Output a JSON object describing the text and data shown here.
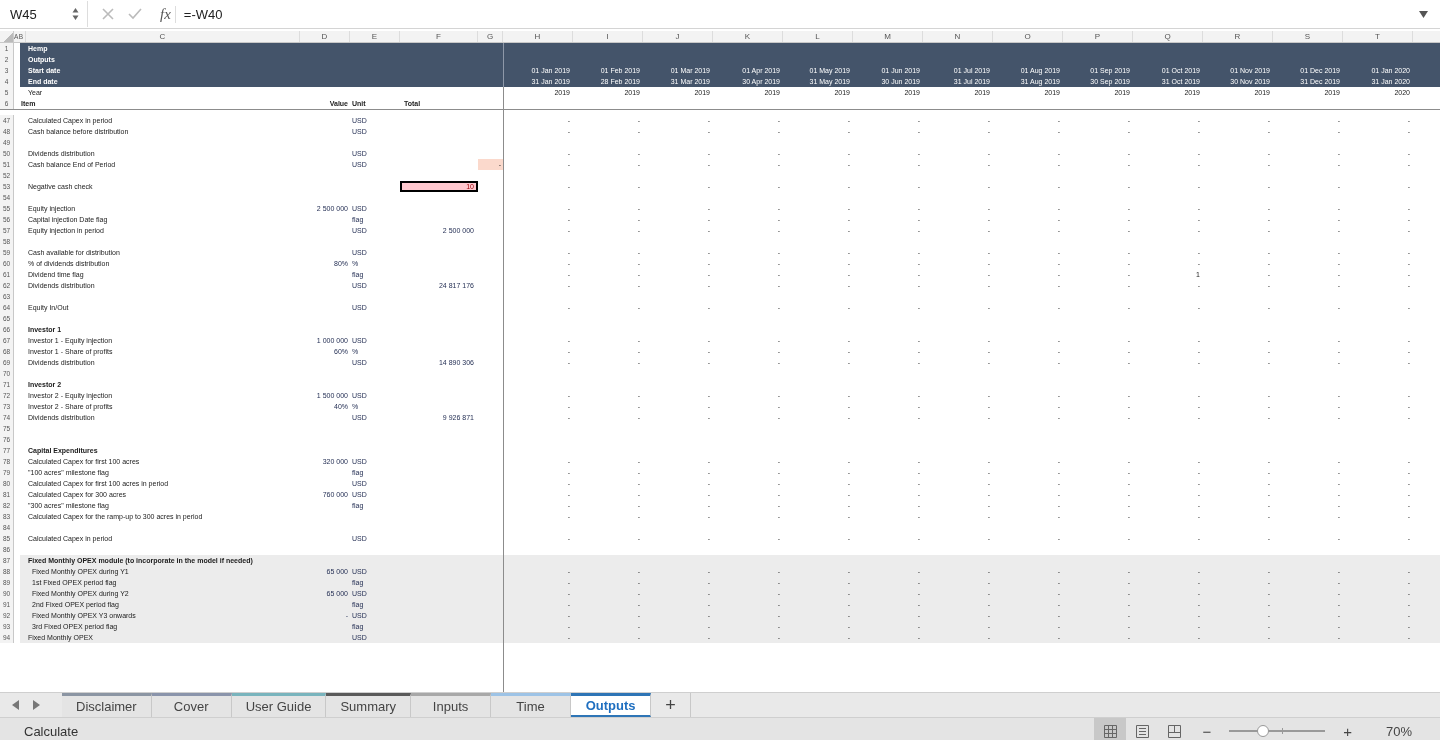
{
  "formula_bar": {
    "name_box": "W45",
    "fx": "fx",
    "formula": "=-W40"
  },
  "column_letters": {
    "ab": "A B",
    "frozen": [
      "C",
      "D",
      "E",
      "F",
      "G"
    ],
    "months": [
      "H",
      "I",
      "J",
      "K",
      "L",
      "M",
      "N",
      "O",
      "P",
      "Q",
      "R",
      "S",
      "T"
    ]
  },
  "header": {
    "title": "Hemp",
    "subtitle": "Outputs",
    "start_label": "Start date",
    "end_label": "End date",
    "year_label": "Year",
    "starts": [
      "01 Jan 2019",
      "01 Feb 2019",
      "01 Mar 2019",
      "01 Apr 2019",
      "01 May 2019",
      "01 Jun 2019",
      "01 Jul 2019",
      "01 Aug 2019",
      "01 Sep 2019",
      "01 Oct 2019",
      "01 Nov 2019",
      "01 Dec 2019",
      "01 Jan 2020"
    ],
    "ends": [
      "31 Jan 2019",
      "28 Feb 2019",
      "31 Mar 2019",
      "30 Apr 2019",
      "31 May 2019",
      "30 Jun 2019",
      "31 Jul 2019",
      "31 Aug 2019",
      "30 Sep 2019",
      "31 Oct 2019",
      "30 Nov 2019",
      "31 Dec 2019",
      "31 Jan 2020"
    ],
    "years": [
      "2019",
      "2019",
      "2019",
      "2019",
      "2019",
      "2019",
      "2019",
      "2019",
      "2019",
      "2019",
      "2019",
      "2019",
      "2020"
    ],
    "item": "Item",
    "value": "Value",
    "unit": "Unit",
    "total": "Total"
  },
  "header_row_numbers": [
    "1",
    "2",
    "3",
    "4",
    "5",
    "6"
  ],
  "rows": [
    {
      "num": "47",
      "kind": "item",
      "shaded": false,
      "label": "Calculated Capex in period",
      "unit": "USD",
      "cells": [
        "-",
        "-",
        "-",
        "-",
        "-",
        "-",
        "-",
        "-",
        "-",
        "-",
        "-",
        "-",
        "-"
      ]
    },
    {
      "num": "48",
      "kind": "item",
      "shaded": false,
      "label": "Cash balance before distribution",
      "unit": "USD",
      "cells": [
        "-",
        "-",
        "-",
        "-",
        "-",
        "-",
        "-",
        "-",
        "-",
        "-",
        "-",
        "-",
        "-"
      ]
    },
    {
      "num": "49",
      "kind": "blank",
      "shaded": false
    },
    {
      "num": "50",
      "kind": "item",
      "shaded": false,
      "label": "Dividends distribution",
      "unit": "USD",
      "cells": [
        "-",
        "-",
        "-",
        "-",
        "-",
        "-",
        "-",
        "-",
        "-",
        "-",
        "-",
        "-",
        "-"
      ]
    },
    {
      "num": "51",
      "kind": "item",
      "shaded": false,
      "label": "Cash balance End of Period",
      "unit": "USD",
      "g": "-",
      "g_highlight": true,
      "cells": [
        "-",
        "-",
        "-",
        "-",
        "-",
        "-",
        "-",
        "-",
        "-",
        "-",
        "-",
        "-",
        "-"
      ]
    },
    {
      "num": "52",
      "kind": "blank",
      "shaded": false
    },
    {
      "num": "53",
      "kind": "item",
      "shaded": false,
      "label": "Negative cash check",
      "total": "10",
      "alert": true,
      "cells": [
        "-",
        "-",
        "-",
        "-",
        "-",
        "-",
        "-",
        "-",
        "-",
        "-",
        "-",
        "-",
        "-"
      ]
    },
    {
      "num": "54",
      "kind": "blank",
      "shaded": false
    },
    {
      "num": "55",
      "kind": "item",
      "shaded": false,
      "label": "Equity injection",
      "value": "2 500 000",
      "unit": "USD",
      "cells": [
        "-",
        "-",
        "-",
        "-",
        "-",
        "-",
        "-",
        "-",
        "-",
        "-",
        "-",
        "-",
        "-"
      ]
    },
    {
      "num": "56",
      "kind": "item",
      "shaded": false,
      "label": "Capital injection Date flag",
      "unit": "flag",
      "cells": [
        "-",
        "-",
        "-",
        "-",
        "-",
        "-",
        "-",
        "-",
        "-",
        "-",
        "-",
        "-",
        "-"
      ]
    },
    {
      "num": "57",
      "kind": "item",
      "shaded": false,
      "label": "Equity injection in period",
      "unit": "USD",
      "total": "2 500 000",
      "alert": false,
      "cells": [
        "-",
        "-",
        "-",
        "-",
        "-",
        "-",
        "-",
        "-",
        "-",
        "-",
        "-",
        "-",
        "-"
      ]
    },
    {
      "num": "58",
      "kind": "blank",
      "shaded": false
    },
    {
      "num": "59",
      "kind": "item",
      "shaded": false,
      "label": "Cash available for distribution",
      "unit": "USD",
      "cells": [
        "-",
        "-",
        "-",
        "-",
        "-",
        "-",
        "-",
        "-",
        "-",
        "-",
        "-",
        "-",
        "-"
      ]
    },
    {
      "num": "60",
      "kind": "item",
      "shaded": false,
      "label": "% of dividends distribution",
      "value": "80%",
      "unit": "%",
      "cells": [
        "-",
        "-",
        "-",
        "-",
        "-",
        "-",
        "-",
        "-",
        "-",
        "-",
        "-",
        "-",
        "-"
      ]
    },
    {
      "num": "61",
      "kind": "item",
      "shaded": false,
      "label": "Dividend time flag",
      "unit": "flag",
      "cells": [
        "-",
        "-",
        "-",
        "-",
        "-",
        "-",
        "-",
        "-",
        "-",
        "1",
        "-",
        "-",
        "-"
      ]
    },
    {
      "num": "62",
      "kind": "item",
      "shaded": false,
      "label": "Dividends distribution",
      "unit": "USD",
      "total": "24 817 176",
      "alert": false,
      "cells": [
        "-",
        "-",
        "-",
        "-",
        "-",
        "-",
        "-",
        "-",
        "-",
        "-",
        "-",
        "-",
        "-"
      ]
    },
    {
      "num": "63",
      "kind": "blank",
      "shaded": false
    },
    {
      "num": "64",
      "kind": "item",
      "shaded": false,
      "label": "Equity In/Out",
      "unit": "USD",
      "cells": [
        "-",
        "-",
        "-",
        "-",
        "-",
        "-",
        "-",
        "-",
        "-",
        "-",
        "-",
        "-",
        "-"
      ]
    },
    {
      "num": "65",
      "kind": "blank",
      "shaded": false
    },
    {
      "num": "66",
      "kind": "heading",
      "shaded": false,
      "label": "Investor 1"
    },
    {
      "num": "67",
      "kind": "item",
      "shaded": false,
      "label": "Investor 1 - Equity injection",
      "value": "1 000 000",
      "unit": "USD",
      "cells": [
        "-",
        "-",
        "-",
        "-",
        "-",
        "-",
        "-",
        "-",
        "-",
        "-",
        "-",
        "-",
        "-"
      ]
    },
    {
      "num": "68",
      "kind": "item",
      "shaded": false,
      "label": "Investor 1 - Share of profits",
      "value": "60%",
      "unit": "%",
      "cells": [
        "-",
        "-",
        "-",
        "-",
        "-",
        "-",
        "-",
        "-",
        "-",
        "-",
        "-",
        "-",
        "-"
      ]
    },
    {
      "num": "69",
      "kind": "item",
      "shaded": false,
      "label": "Dividends distribution",
      "unit": "USD",
      "total": "14 890 306",
      "alert": false,
      "cells": [
        "-",
        "-",
        "-",
        "-",
        "-",
        "-",
        "-",
        "-",
        "-",
        "-",
        "-",
        "-",
        "-"
      ]
    },
    {
      "num": "70",
      "kind": "blank",
      "shaded": false
    },
    {
      "num": "71",
      "kind": "heading",
      "shaded": false,
      "label": "Investor 2"
    },
    {
      "num": "72",
      "kind": "item",
      "shaded": false,
      "label": "Investor 2 - Equity injection",
      "value": "1 500 000",
      "unit": "USD",
      "cells": [
        "-",
        "-",
        "-",
        "-",
        "-",
        "-",
        "-",
        "-",
        "-",
        "-",
        "-",
        "-",
        "-"
      ]
    },
    {
      "num": "73",
      "kind": "item",
      "shaded": false,
      "label": "Investor 2 - Share of profits",
      "value": "40%",
      "unit": "%",
      "cells": [
        "-",
        "-",
        "-",
        "-",
        "-",
        "-",
        "-",
        "-",
        "-",
        "-",
        "-",
        "-",
        "-"
      ]
    },
    {
      "num": "74",
      "kind": "item",
      "shaded": false,
      "label": "Dividends distribution",
      "unit": "USD",
      "total": "9 926 871",
      "alert": false,
      "cells": [
        "-",
        "-",
        "-",
        "-",
        "-",
        "-",
        "-",
        "-",
        "-",
        "-",
        "-",
        "-",
        "-"
      ]
    },
    {
      "num": "75",
      "kind": "blank",
      "shaded": false
    },
    {
      "num": "76",
      "kind": "blank",
      "shaded": false
    },
    {
      "num": "77",
      "kind": "heading",
      "shaded": false,
      "label": "Capital Expenditures"
    },
    {
      "num": "78",
      "kind": "item",
      "shaded": false,
      "label": "Calculated Capex for first 100 acres",
      "value": "320 000",
      "unit": "USD",
      "cells": [
        "-",
        "-",
        "-",
        "-",
        "-",
        "-",
        "-",
        "-",
        "-",
        "-",
        "-",
        "-",
        "-"
      ]
    },
    {
      "num": "79",
      "kind": "item",
      "shaded": false,
      "label": "\"100 acres\" milestone flag",
      "unit": "flag",
      "cells": [
        "-",
        "-",
        "-",
        "-",
        "-",
        "-",
        "-",
        "-",
        "-",
        "-",
        "-",
        "-",
        "-"
      ]
    },
    {
      "num": "80",
      "kind": "item",
      "shaded": false,
      "label": "Calculated Capex for first 100 acres in period",
      "unit": "USD",
      "cells": [
        "-",
        "-",
        "-",
        "-",
        "-",
        "-",
        "-",
        "-",
        "-",
        "-",
        "-",
        "-",
        "-"
      ]
    },
    {
      "num": "81",
      "kind": "item",
      "shaded": false,
      "label": "Calculated Capex for 300 acres",
      "value": "760 000",
      "unit": "USD",
      "cells": [
        "-",
        "-",
        "-",
        "-",
        "-",
        "-",
        "-",
        "-",
        "-",
        "-",
        "-",
        "-",
        "-"
      ]
    },
    {
      "num": "82",
      "kind": "item",
      "shaded": false,
      "label": "\"300 acres\" milestone flag",
      "unit": "flag",
      "cells": [
        "-",
        "-",
        "-",
        "-",
        "-",
        "-",
        "-",
        "-",
        "-",
        "-",
        "-",
        "-",
        "-"
      ]
    },
    {
      "num": "83",
      "kind": "item",
      "shaded": false,
      "label": "Calculated Capex for the ramp-up to 300 acres in period",
      "cells": [
        "-",
        "-",
        "-",
        "-",
        "-",
        "-",
        "-",
        "-",
        "-",
        "-",
        "-",
        "-",
        "-"
      ]
    },
    {
      "num": "84",
      "kind": "blank",
      "shaded": false
    },
    {
      "num": "85",
      "kind": "item",
      "shaded": false,
      "label": "Calculated Capex in period",
      "unit": "USD",
      "cells": [
        "-",
        "-",
        "-",
        "-",
        "-",
        "-",
        "-",
        "-",
        "-",
        "-",
        "-",
        "-",
        "-"
      ]
    },
    {
      "num": "86",
      "kind": "blank",
      "shaded": false
    },
    {
      "num": "87",
      "kind": "heading",
      "shaded": true,
      "label": "Fixed Monthly OPEX module (to incorporate in the model if needed)"
    },
    {
      "num": "88",
      "kind": "sub",
      "shaded": true,
      "label": "Fixed Monthly OPEX during Y1",
      "value": "65 000",
      "unit": "USD",
      "cells": [
        "-",
        "-",
        "-",
        "-",
        "-",
        "-",
        "-",
        "-",
        "-",
        "-",
        "-",
        "-",
        "-"
      ]
    },
    {
      "num": "89",
      "kind": "sub",
      "shaded": true,
      "label": "1st Fixed OPEX period flag",
      "unit": "flag",
      "cells": [
        "-",
        "-",
        "-",
        "-",
        "-",
        "-",
        "-",
        "-",
        "-",
        "-",
        "-",
        "-",
        "-"
      ]
    },
    {
      "num": "90",
      "kind": "sub",
      "shaded": true,
      "label": "Fixed Monthly OPEX during Y2",
      "value": "65 000",
      "unit": "USD",
      "cells": [
        "-",
        "-",
        "-",
        "-",
        "-",
        "-",
        "-",
        "-",
        "-",
        "-",
        "-",
        "-",
        "-"
      ]
    },
    {
      "num": "91",
      "kind": "sub",
      "shaded": true,
      "label": "2nd Fixed OPEX period flag",
      "unit": "flag",
      "cells": [
        "-",
        "-",
        "-",
        "-",
        "-",
        "-",
        "-",
        "-",
        "-",
        "-",
        "-",
        "-",
        "-"
      ]
    },
    {
      "num": "92",
      "kind": "sub",
      "shaded": true,
      "label": "Fixed Monthly OPEX Y3 onwards",
      "value": "-",
      "unit": "USD",
      "cells": [
        "-",
        "-",
        "-",
        "-",
        "-",
        "-",
        "-",
        "-",
        "-",
        "-",
        "-",
        "-",
        "-"
      ]
    },
    {
      "num": "93",
      "kind": "sub",
      "shaded": true,
      "label": "3rd Fixed OPEX period flag",
      "unit": "flag",
      "cells": [
        "-",
        "-",
        "-",
        "-",
        "-",
        "-",
        "-",
        "-",
        "-",
        "-",
        "-",
        "-",
        "-"
      ]
    },
    {
      "num": "94",
      "kind": "item",
      "shaded": true,
      "label": "Fixed Monthly OPEX",
      "unit": "USD",
      "cells": [
        "-",
        "-",
        "-",
        "-",
        "-",
        "-",
        "-",
        "-",
        "-",
        "-",
        "-",
        "-",
        "-"
      ]
    }
  ],
  "sheet_tabs": [
    {
      "label": "Disclaimer",
      "selected": false,
      "color": "#8b95a3"
    },
    {
      "label": "Cover",
      "selected": false,
      "color": "#8a94ab"
    },
    {
      "label": "User Guide",
      "selected": false,
      "color": "#79b4bd"
    },
    {
      "label": "Summary",
      "selected": false,
      "color": "#5a5a5a"
    },
    {
      "label": "Inputs",
      "selected": false,
      "color": "#a8a8a8"
    },
    {
      "label": "Time",
      "selected": false,
      "color": "#9dc3e6"
    },
    {
      "label": "Outputs",
      "selected": true,
      "color": "#2e75b6"
    }
  ],
  "add_sheet": "+",
  "status": {
    "mode": "Calculate",
    "views": [
      {
        "kind": "normal",
        "selected": true
      },
      {
        "kind": "page_layout",
        "selected": false
      },
      {
        "kind": "page_break",
        "selected": false
      }
    ],
    "zoom_out": "−",
    "zoom_in": "+",
    "zoom": {
      "level": 0.35,
      "label": "70%"
    }
  }
}
